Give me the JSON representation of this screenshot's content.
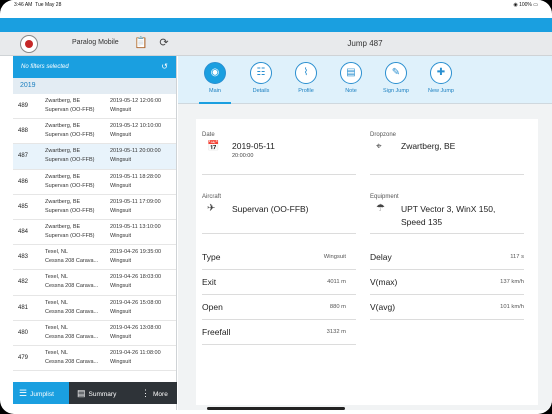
{
  "status": {
    "time": "3:46 AM",
    "date": "Tue May 28",
    "battery": "100%"
  },
  "header": {
    "app_name": "Paralog Mobile",
    "title": "Jump 487"
  },
  "sidebar": {
    "filter_text": "No filters selected",
    "year": "2019",
    "rows": [
      {
        "num": "489",
        "location": "Zwartberg, BE",
        "aircraft": "Supervan (OO-FFB)",
        "datetime": "2019-05-12 12:06:00",
        "type": "Wingsuit"
      },
      {
        "num": "488",
        "location": "Zwartberg, BE",
        "aircraft": "Supervan (OO-FFB)",
        "datetime": "2019-05-12 10:10:00",
        "type": "Wingsuit"
      },
      {
        "num": "487",
        "location": "Zwartberg, BE",
        "aircraft": "Supervan (OO-FFB)",
        "datetime": "2019-05-11 20:00:00",
        "type": "Wingsuit"
      },
      {
        "num": "486",
        "location": "Zwartberg, BE",
        "aircraft": "Supervan (OO-FFB)",
        "datetime": "2019-05-11 18:28:00",
        "type": "Wingsuit"
      },
      {
        "num": "485",
        "location": "Zwartberg, BE",
        "aircraft": "Supervan (OO-FFB)",
        "datetime": "2019-05-11 17:09:00",
        "type": "Wingsuit"
      },
      {
        "num": "484",
        "location": "Zwartberg, BE",
        "aircraft": "Supervan (OO-FFB)",
        "datetime": "2019-05-11 13:10:00",
        "type": "Wingsuit"
      },
      {
        "num": "483",
        "location": "Texel, NL",
        "aircraft": "Cessna 208 Carava...",
        "datetime": "2019-04-26 19:35:00",
        "type": "Wingsuit"
      },
      {
        "num": "482",
        "location": "Texel, NL",
        "aircraft": "Cessna 208 Carava...",
        "datetime": "2019-04-26 18:03:00",
        "type": "Wingsuit"
      },
      {
        "num": "481",
        "location": "Texel, NL",
        "aircraft": "Cessna 208 Carava...",
        "datetime": "2019-04-26 15:08:00",
        "type": "Wingsuit"
      },
      {
        "num": "480",
        "location": "Texel, NL",
        "aircraft": "Cessna 208 Carava...",
        "datetime": "2019-04-26 13:08:00",
        "type": "Wingsuit"
      },
      {
        "num": "479",
        "location": "Texel, NL",
        "aircraft": "Cessna 208 Carava...",
        "datetime": "2019-04-26 11:08:00",
        "type": "Wingsuit"
      }
    ],
    "selected_index": 2
  },
  "tabbar": {
    "jumplist": "Jumplist",
    "summary": "Summary",
    "more": "More"
  },
  "toolbar": {
    "main": "Main",
    "details": "Details",
    "profile": "Profile",
    "note": "Note",
    "sign_jump": "Sign Jump",
    "new_jump": "New Jump"
  },
  "detail": {
    "date_label": "Date",
    "date_value": "2019-05-11",
    "time_value": "20:00:00",
    "dropzone_label": "Dropzone",
    "dropzone_value": "Zwartberg, BE",
    "aircraft_label": "Aircraft",
    "aircraft_value": "Supervan (OO-FFB)",
    "equipment_label": "Equipment",
    "equipment_line1": "UPT Vector 3, WinX 150,",
    "equipment_line2": "Speed 135",
    "type_label": "Type",
    "type_value": "Wingsuit",
    "exit_label": "Exit",
    "exit_value": "4011 m",
    "open_label": "Open",
    "open_value": "880 m",
    "freefall_label": "Freefall",
    "freefall_value": "3132 m",
    "delay_label": "Delay",
    "delay_value": "117 s",
    "vmax_label": "V(max)",
    "vmax_value": "137 km/h",
    "vavg_label": "V(avg)",
    "vavg_value": "101 km/h"
  },
  "colors": {
    "accent": "#1a9fe0",
    "toolbar_bg": "#dff1fb",
    "sidebar_dark": "#2e3338"
  }
}
